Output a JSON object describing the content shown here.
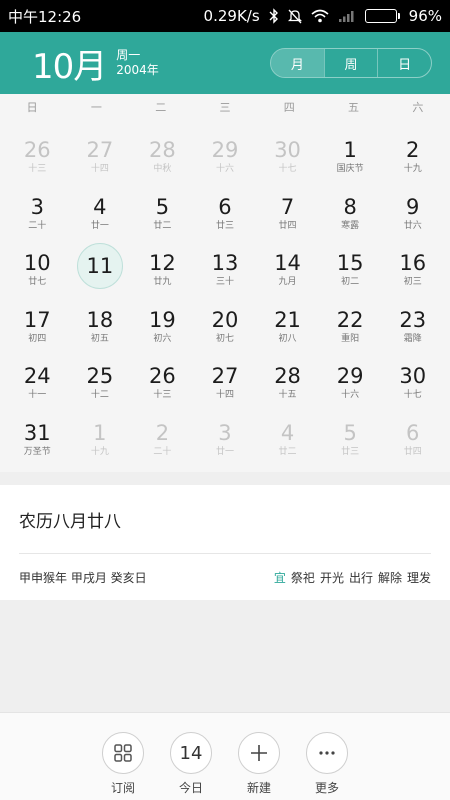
{
  "status": {
    "time": "中午12:26",
    "network_speed": "0.29K/s",
    "battery": "96%",
    "battery_level": 0.96
  },
  "header": {
    "month": "10月",
    "weekday": "周一",
    "year": "2004年",
    "views": [
      "月",
      "周",
      "日"
    ]
  },
  "weekdays": [
    "日",
    "一",
    "二",
    "三",
    "四",
    "五",
    "六"
  ],
  "days": [
    {
      "num": "26",
      "lunar": "十三",
      "other": true
    },
    {
      "num": "27",
      "lunar": "十四",
      "other": true
    },
    {
      "num": "28",
      "lunar": "中秋",
      "other": true
    },
    {
      "num": "29",
      "lunar": "十六",
      "other": true
    },
    {
      "num": "30",
      "lunar": "十七",
      "other": true
    },
    {
      "num": "1",
      "lunar": "国庆节"
    },
    {
      "num": "2",
      "lunar": "十九"
    },
    {
      "num": "3",
      "lunar": "二十"
    },
    {
      "num": "4",
      "lunar": "廿一"
    },
    {
      "num": "5",
      "lunar": "廿二"
    },
    {
      "num": "6",
      "lunar": "廿三"
    },
    {
      "num": "7",
      "lunar": "廿四"
    },
    {
      "num": "8",
      "lunar": "寒露"
    },
    {
      "num": "9",
      "lunar": "廿六"
    },
    {
      "num": "10",
      "lunar": "廿七"
    },
    {
      "num": "11",
      "lunar": "",
      "today": true
    },
    {
      "num": "12",
      "lunar": "廿九"
    },
    {
      "num": "13",
      "lunar": "三十"
    },
    {
      "num": "14",
      "lunar": "九月"
    },
    {
      "num": "15",
      "lunar": "初二"
    },
    {
      "num": "16",
      "lunar": "初三"
    },
    {
      "num": "17",
      "lunar": "初四"
    },
    {
      "num": "18",
      "lunar": "初五"
    },
    {
      "num": "19",
      "lunar": "初六"
    },
    {
      "num": "20",
      "lunar": "初七"
    },
    {
      "num": "21",
      "lunar": "初八"
    },
    {
      "num": "22",
      "lunar": "重阳"
    },
    {
      "num": "23",
      "lunar": "霜降"
    },
    {
      "num": "24",
      "lunar": "十一"
    },
    {
      "num": "25",
      "lunar": "十二"
    },
    {
      "num": "26",
      "lunar": "十三"
    },
    {
      "num": "27",
      "lunar": "十四"
    },
    {
      "num": "28",
      "lunar": "十五"
    },
    {
      "num": "29",
      "lunar": "十六"
    },
    {
      "num": "30",
      "lunar": "十七"
    },
    {
      "num": "31",
      "lunar": "万圣节"
    },
    {
      "num": "1",
      "lunar": "十九",
      "other": true
    },
    {
      "num": "2",
      "lunar": "二十",
      "other": true
    },
    {
      "num": "3",
      "lunar": "廿一",
      "other": true
    },
    {
      "num": "4",
      "lunar": "廿二",
      "other": true
    },
    {
      "num": "5",
      "lunar": "廿三",
      "other": true
    },
    {
      "num": "6",
      "lunar": "廿四",
      "other": true
    }
  ],
  "info": {
    "lunar_date": "农历八月廿八",
    "ganzhi": "甲申猴年 甲戌月 癸亥日",
    "yi_label": "宜",
    "yi_items": [
      "祭祀",
      "开光",
      "出行",
      "解除",
      "理发"
    ]
  },
  "toolbar": {
    "subscribe": "订阅",
    "today": "今日",
    "today_num": "14",
    "new": "新建",
    "more": "更多"
  },
  "colors": {
    "accent": "#2fa89a"
  }
}
